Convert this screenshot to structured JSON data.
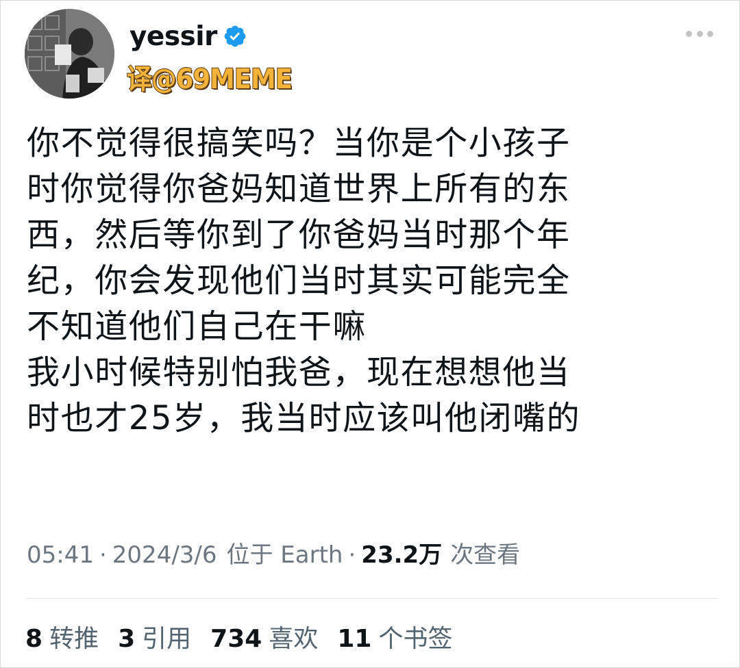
{
  "author": {
    "display_name": "yessir",
    "verified": true,
    "translator_credit": "译@69MEME",
    "avatar_icon": "user-avatar-photo"
  },
  "tweet": {
    "lines": [
      "你不觉得很搞笑吗？当你是个小孩子",
      "时你觉得你爸妈知道世界上所有的东",
      "西，然后等你到了你爸妈当时那个年",
      "纪，你会发现他们当时其实可能完全",
      "不知道他们自己在干嘛",
      "我小时候特别怕我爸，现在想想他当",
      "时也才25岁，我当时应该叫他闭嘴的"
    ]
  },
  "meta": {
    "time": "05:41",
    "separator": "·",
    "date": "2024/3/6",
    "location": "位于 Earth",
    "views_count": "23.2万",
    "views_label": "次查看"
  },
  "stats": {
    "retweets": {
      "num": "8",
      "label": "转推"
    },
    "quotes": {
      "num": "3",
      "label": "引用"
    },
    "likes": {
      "num": "734",
      "label": "喜欢"
    },
    "bookmarks": {
      "num": "11",
      "label": "个书签"
    }
  },
  "colors": {
    "verified_badge": "#1d9bf0",
    "translator_fill": "#f3b23a",
    "translator_outline": "#5a3812",
    "meta_text": "#6b7680"
  }
}
